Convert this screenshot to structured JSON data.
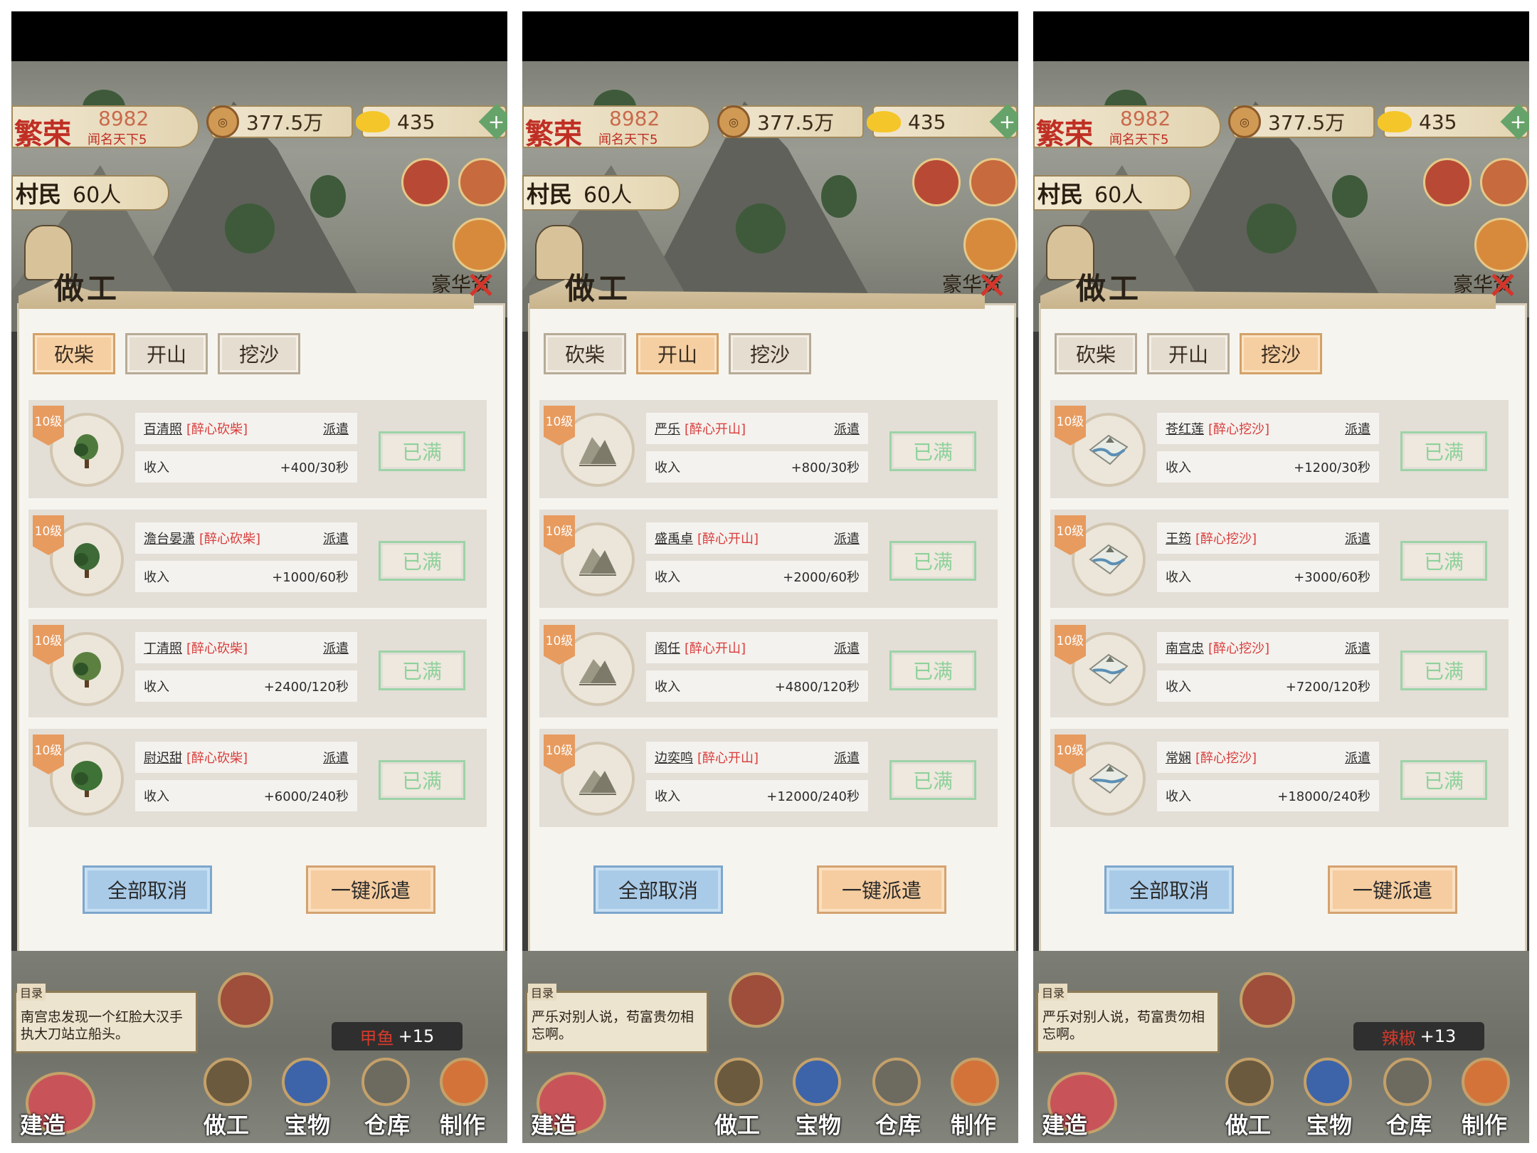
{
  "panels": [
    {
      "resources": {
        "fame_title": "繁荣",
        "fame_value": "8982",
        "fame_sub": "闻名天下5",
        "coins": "377.5万",
        "ingots": "435"
      },
      "villagers": {
        "label": "村民",
        "count": "60人"
      },
      "dialog": {
        "title": "做工",
        "luxury": "豪华资助"
      },
      "tabs": [
        {
          "label": "砍柴"
        },
        {
          "label": "开山"
        },
        {
          "label": "挖沙"
        }
      ],
      "rows": [
        {
          "level": "10级",
          "name": "百清照",
          "tag": "[醉心砍柴]",
          "dispatch": "派遣",
          "income_label": "收入",
          "income": "+400/30秒",
          "status": "已满"
        },
        {
          "level": "10级",
          "name": "澹台晏潇",
          "tag": "[醉心砍柴]",
          "dispatch": "派遣",
          "income_label": "收入",
          "income": "+1000/60秒",
          "status": "已满"
        },
        {
          "level": "10级",
          "name": "丁清照",
          "tag": "[醉心砍柴]",
          "dispatch": "派遣",
          "income_label": "收入",
          "income": "+2400/120秒",
          "status": "已满"
        },
        {
          "level": "10级",
          "name": "尉迟甜",
          "tag": "[醉心砍柴]",
          "dispatch": "派遣",
          "income_label": "收入",
          "income": "+6000/240秒",
          "status": "已满"
        }
      ],
      "buttons": {
        "cancel_all": "全部取消",
        "dispatch_all": "一键派遣"
      },
      "message": {
        "tag": "目录",
        "text": "南宫忠发现一个红脸大汉手执大刀站立船头。"
      },
      "reward": {
        "item": "甲鱼",
        "amount": "+15"
      },
      "nav": [
        "建造",
        "做工",
        "宝物",
        "仓库",
        "制作"
      ]
    },
    {
      "resources": {
        "fame_title": "繁荣",
        "fame_value": "8982",
        "fame_sub": "闻名天下5",
        "coins": "377.5万",
        "ingots": "435"
      },
      "villagers": {
        "label": "村民",
        "count": "60人"
      },
      "dialog": {
        "title": "做工",
        "luxury": "豪华资助"
      },
      "tabs": [
        {
          "label": "砍柴"
        },
        {
          "label": "开山"
        },
        {
          "label": "挖沙"
        }
      ],
      "rows": [
        {
          "level": "10级",
          "name": "严乐",
          "tag": "[醉心开山]",
          "dispatch": "派遣",
          "income_label": "收入",
          "income": "+800/30秒",
          "status": "已满"
        },
        {
          "level": "10级",
          "name": "盛禹卓",
          "tag": "[醉心开山]",
          "dispatch": "派遣",
          "income_label": "收入",
          "income": "+2000/60秒",
          "status": "已满"
        },
        {
          "level": "10级",
          "name": "阂任",
          "tag": "[醉心开山]",
          "dispatch": "派遣",
          "income_label": "收入",
          "income": "+4800/120秒",
          "status": "已满"
        },
        {
          "level": "10级",
          "name": "边奕鸣",
          "tag": "[醉心开山]",
          "dispatch": "派遣",
          "income_label": "收入",
          "income": "+12000/240秒",
          "status": "已满"
        }
      ],
      "buttons": {
        "cancel_all": "全部取消",
        "dispatch_all": "一键派遣"
      },
      "message": {
        "tag": "目录",
        "text": "严乐对别人说，苟富贵勿相忘啊。"
      },
      "reward": {
        "item": "",
        "amount": ""
      },
      "nav": [
        "建造",
        "做工",
        "宝物",
        "仓库",
        "制作"
      ]
    },
    {
      "resources": {
        "fame_title": "繁荣",
        "fame_value": "8982",
        "fame_sub": "闻名天下5",
        "coins": "377.5万",
        "ingots": "435"
      },
      "villagers": {
        "label": "村民",
        "count": "60人"
      },
      "dialog": {
        "title": "做工",
        "luxury": "豪华资助"
      },
      "tabs": [
        {
          "label": "砍柴"
        },
        {
          "label": "开山"
        },
        {
          "label": "挖沙"
        }
      ],
      "rows": [
        {
          "level": "10级",
          "name": "苍红莲",
          "tag": "[醉心挖沙]",
          "dispatch": "派遣",
          "income_label": "收入",
          "income": "+1200/30秒",
          "status": "已满"
        },
        {
          "level": "10级",
          "name": "王筠",
          "tag": "[醉心挖沙]",
          "dispatch": "派遣",
          "income_label": "收入",
          "income": "+3000/60秒",
          "status": "已满"
        },
        {
          "level": "10级",
          "name": "南宫忠",
          "tag": "[醉心挖沙]",
          "dispatch": "派遣",
          "income_label": "收入",
          "income": "+7200/120秒",
          "status": "已满"
        },
        {
          "level": "10级",
          "name": "常娴",
          "tag": "[醉心挖沙]",
          "dispatch": "派遣",
          "income_label": "收入",
          "income": "+18000/240秒",
          "status": "已满"
        }
      ],
      "buttons": {
        "cancel_all": "全部取消",
        "dispatch_all": "一键派遣"
      },
      "message": {
        "tag": "目录",
        "text": "严乐对别人说，苟富贵勿相忘啊。"
      },
      "reward": {
        "item": "辣椒",
        "amount": "+13"
      },
      "nav": [
        "建造",
        "做工",
        "宝物",
        "仓库",
        "制作"
      ]
    }
  ],
  "active_tab": [
    0,
    1,
    2
  ],
  "row_icon_kinds": [
    "tree-icon",
    "mountain-icon",
    "river-sand-icon"
  ],
  "colors": {
    "active_tab": "#f5cfa2",
    "full_text": "#8fd19b",
    "tag_red": "#d83b3b",
    "cancel_btn": "#a9cbe8",
    "dispatch_btn": "#f6cda0"
  }
}
